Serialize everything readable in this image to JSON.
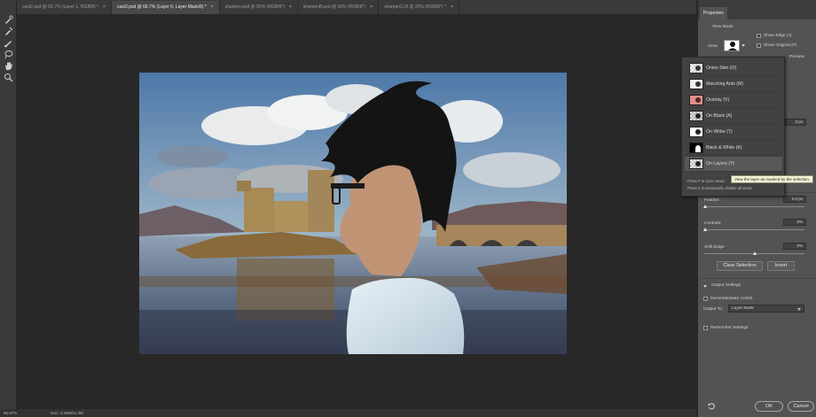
{
  "tabs": [
    {
      "label": "cast2.psd @ 66.7% (Layer 1, RGB/8) *",
      "active": false
    },
    {
      "label": "cast3.psd @ 66.7% (Layer 0, Layer Mask/8) *",
      "active": true
    },
    {
      "label": "sharpen.psd @ 50% (RGB/8*)",
      "active": false
    },
    {
      "label": "sharpenB.psd @ 50% (RGB/8*)",
      "active": false
    },
    {
      "label": "sharpenC.tif @ 25% (RGB/8*) *",
      "active": false
    }
  ],
  "tab_close": "×",
  "tools": [
    "quick-selection-icon",
    "refine-edge-brush-icon",
    "brush-icon",
    "lasso-icon",
    "hand-icon",
    "zoom-icon"
  ],
  "status": {
    "zoom": "66.67%",
    "doc": "Doc: 4.28M/11.4M"
  },
  "properties": {
    "tab": "Properties",
    "view_mode": "View Mode",
    "view_label": "View:",
    "show_edge": "Show Edge (J)",
    "show_original": "Show Original (P)",
    "preview": "Preview",
    "radius_value": "3 px",
    "feather_label": "Feather:",
    "feather_value": "0.0 px",
    "contrast_label": "Contrast:",
    "contrast_value": "0%",
    "shift_edge_label": "Shift Edge:",
    "shift_edge_value": "0%",
    "clear_selection": "Clear Selection",
    "invert": "Invert",
    "output_settings": "Output Settings",
    "decontaminate": "Decontaminate Colors",
    "output_to_label": "Output To:",
    "output_to_value": "Layer Mask",
    "remember": "Remember Settings",
    "ok": "OK",
    "cancel": "Cancel"
  },
  "view_menu": {
    "items": [
      {
        "label": "Onion Skin (O)",
        "thumb": "onion"
      },
      {
        "label": "Marching Ants (M)",
        "thumb": "ants"
      },
      {
        "label": "Overlay (V)",
        "thumb": "overlay"
      },
      {
        "label": "On Black (A)",
        "thumb": "black"
      },
      {
        "label": "On White (T)",
        "thumb": "white"
      },
      {
        "label": "Black & White (K)",
        "thumb": "bw"
      },
      {
        "label": "On Layers (Y)",
        "thumb": "layers"
      }
    ],
    "hint1": "Press F to cycle views.",
    "hint2": "Press X to temporarily disable all views.",
    "tooltip": "View the layer as masked by the selection."
  },
  "colors": {
    "accent": "#2d8ceb",
    "panel": "#535353",
    "canvas": "#282828"
  }
}
